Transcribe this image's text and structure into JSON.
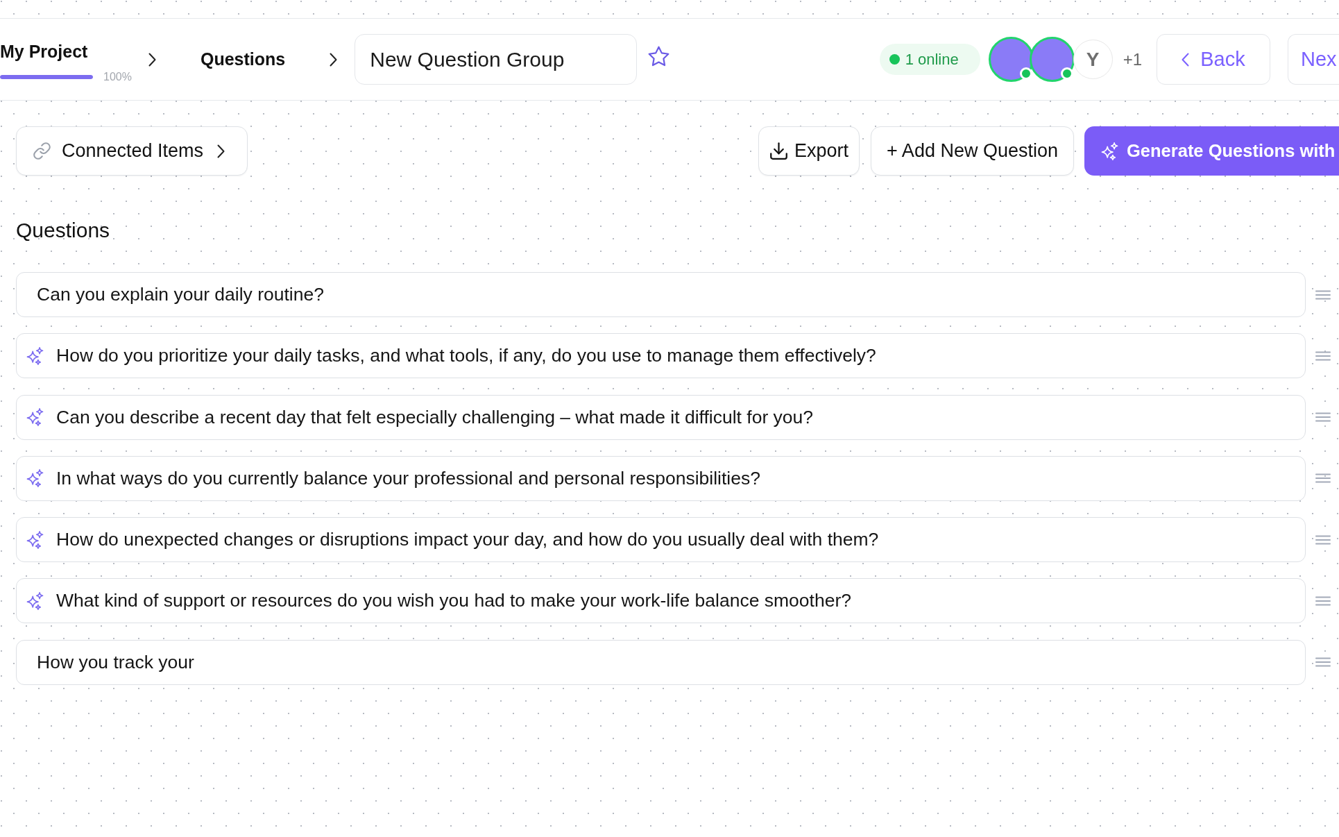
{
  "header": {
    "project": {
      "name": "My Project",
      "level": 1,
      "percent": "100%"
    },
    "breadcrumb": {
      "label": "Questions"
    },
    "title_field": {
      "value": "New Question Group"
    },
    "favorite": {
      "starred": false
    },
    "presence": {
      "label": "1 online"
    },
    "avatars": [
      {
        "kind": "image",
        "online": true
      },
      {
        "kind": "image",
        "online": true
      },
      {
        "kind": "initial",
        "initial": "Y",
        "online": false
      }
    ],
    "more_count": "+1",
    "back_button": {
      "label": "Back"
    },
    "next_button": {
      "label": "Nex"
    }
  },
  "toolbar": {
    "connected_items": {
      "label": "Connected Items"
    },
    "buttons": [
      {
        "kind": "export",
        "label": "Export"
      },
      {
        "kind": "add",
        "label": "+ Add New Question"
      },
      {
        "kind": "generate",
        "label": "Generate Questions with"
      }
    ]
  },
  "questions": {
    "heading": "Questions",
    "items": [
      {
        "text": "Can you explain your daily routine?",
        "ai_generated": false
      },
      {
        "text": "How do you prioritize your daily tasks, and what tools, if any, do you use to manage them effectively?",
        "ai_generated": true
      },
      {
        "text": "Can you describe a recent day that felt especially challenging – what made it difficult for you?",
        "ai_generated": true
      },
      {
        "text": "In what ways do you currently balance your professional and personal responsibilities?",
        "ai_generated": true
      },
      {
        "text": "How do unexpected changes or disruptions impact your day, and how do you usually deal with them?",
        "ai_generated": true
      },
      {
        "text": "What kind of support or resources do you wish you had to make your work-life balance smoother?",
        "ai_generated": true
      },
      {
        "text": "How you track your",
        "ai_generated": false
      }
    ]
  }
}
